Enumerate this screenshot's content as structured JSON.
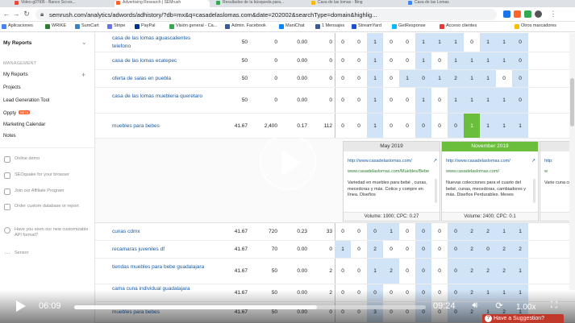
{
  "browser": {
    "tabs": [
      {
        "label": "Video-g07t06 - Banco Sci-ex...",
        "color": "#e74c3c"
      },
      {
        "label": "Advertising Research | SEMrush",
        "color": "#ff642d"
      },
      {
        "label": "Resultados de la búsqueda para...",
        "color": "#34a853"
      },
      {
        "label": "Casa de las lomas - Bing",
        "color": "#fbbc05"
      },
      {
        "label": "Casa de las Lomas",
        "color": "#4285f4"
      }
    ],
    "url": "semrush.com/analytics/adwords/adhistory/?db=mx&q=casadelaslomas.com&date=202002&searchType=domain&highlig..."
  },
  "bookmarks": [
    {
      "label": "Aplicaciones",
      "color": "#4285f4"
    },
    {
      "label": "WRIKE",
      "color": "#2e7d32"
    },
    {
      "label": "SumCart",
      "color": "#3b82c4"
    },
    {
      "label": "Stripe",
      "color": "#6772e5"
    },
    {
      "label": "PayPal",
      "color": "#003087"
    },
    {
      "label": "Visión general - Ca...",
      "color": "#34a853"
    },
    {
      "label": "Admin. Facebook",
      "color": "#3b5998"
    },
    {
      "label": "ManiChat",
      "color": "#0084ff"
    },
    {
      "label": "1 Mensajes",
      "color": "#3b5998"
    },
    {
      "label": "StreamYard",
      "color": "#1d4ed8"
    },
    {
      "label": "GetResponse",
      "color": "#00baff"
    },
    {
      "label": "Acceso clientes",
      "color": "#e53935"
    },
    {
      "label": "Otros marcadores",
      "color": "#fbbc05"
    }
  ],
  "sidebar": {
    "title": "My Reports",
    "section": "MANAGEMENT",
    "items": [
      {
        "label": "My Reports"
      },
      {
        "label": "Projects"
      },
      {
        "label": "Lead Generation Tool"
      },
      {
        "label": "Oppty",
        "badge": "BETA"
      },
      {
        "label": "Marketing Calendar"
      },
      {
        "label": "Notes"
      }
    ],
    "links": [
      {
        "label": "Online demo"
      },
      {
        "label": "SEOquake for your browser"
      },
      {
        "label": "Join our Affiliate Program"
      },
      {
        "label": "Order custom database or report"
      },
      {
        "label": "Have you seen our new customizable API format?"
      },
      {
        "label": "Sensor"
      }
    ]
  },
  "table": {
    "rows_top": [
      {
        "keyword": "casa de las lomas aguascalientes telefono",
        "kd": "50",
        "vol": "0",
        "cpc": "0.00",
        "com": "0",
        "trend": [
          "0",
          "0",
          "1",
          "0",
          "0",
          "1",
          "1",
          "1",
          "0",
          "1",
          "1",
          "0"
        ]
      },
      {
        "keyword": "casa de las lomas ecatepec",
        "kd": "50",
        "vol": "0",
        "cpc": "0.00",
        "com": "0",
        "trend": [
          "0",
          "0",
          "1",
          "0",
          "0",
          "1",
          "0",
          "1",
          "1",
          "1",
          "1",
          "0"
        ]
      },
      {
        "keyword": "oferta de salas en puebla",
        "kd": "50",
        "vol": "0",
        "cpc": "0.00",
        "com": "0",
        "trend": [
          "0",
          "0",
          "1",
          "0",
          "1",
          "0",
          "1",
          "2",
          "1",
          "1",
          "0",
          "0"
        ]
      },
      {
        "keyword": "casa de las lomas muebleria queretaro",
        "kd": "50",
        "vol": "0",
        "cpc": "0.00",
        "com": "0",
        "trend": [
          "0",
          "0",
          "1",
          "0",
          "0",
          "1",
          "0",
          "1",
          "1",
          "1",
          "1",
          "0"
        ]
      },
      {
        "keyword": "muebles para bebes",
        "kd": "41.67",
        "vol": "2,400",
        "cpc": "0.17",
        "com": "112",
        "trend": [
          "0",
          "0",
          "1",
          "0",
          "0",
          "0",
          "0",
          "0",
          "1",
          "1",
          "1",
          "1"
        ]
      }
    ],
    "snapshots": [
      {
        "month": "May 2019",
        "link": "http://www.casadelaslomas.com/",
        "display": "www.casadelaslomas.com/Muebles/Bebe",
        "desc": "Variedad en muebles para bebé , cunas, mecedoras y más. Cotice y compre en línea. Diseños",
        "foot": "Volume: 1900; CPC: 0.27"
      },
      {
        "month": "November 2019",
        "link": "http://www.casadelaslomas.com/",
        "display": "www.casadelaslomas.com/",
        "desc": "Nuevas colecciones para el cuarto del bebé, cunas, mecedoras, cambiadores y más. Diseños Perdurables. Meses",
        "foot": "Volume: 2400; CPC: 0.1"
      },
      {
        "month": "",
        "link": "http:",
        "display": "w",
        "desc": "Varie cuna comp",
        "foot": "Volume"
      }
    ],
    "rows_bottom": [
      {
        "keyword": "cunas cdmx",
        "kd": "41.67",
        "vol": "720",
        "cpc": "0.23",
        "com": "33",
        "trend": [
          "0",
          "0",
          "0",
          "1",
          "0",
          "0",
          "0",
          "0",
          "2",
          "2",
          "1",
          "1"
        ]
      },
      {
        "keyword": "recamaras juveniles df",
        "kd": "41.67",
        "vol": "70",
        "cpc": "0.00",
        "com": "0",
        "trend": [
          "1",
          "0",
          "2",
          "0",
          "0",
          "0",
          "0",
          "0",
          "2",
          "0",
          "2",
          "2"
        ]
      },
      {
        "keyword": "tiendas muebles para bebe guadalajara",
        "kd": "41.67",
        "vol": "50",
        "cpc": "0.00",
        "com": "2",
        "trend": [
          "0",
          "0",
          "1",
          "2",
          "0",
          "0",
          "0",
          "0",
          "2",
          "2",
          "2",
          "1"
        ]
      },
      {
        "keyword": "cama cuna individual guadalajara",
        "kd": "41.67",
        "vol": "50",
        "cpc": "0.00",
        "com": "2",
        "trend": [
          "0",
          "0",
          "0",
          "0",
          "0",
          "0",
          "0",
          "0",
          "2",
          "1",
          "1",
          "1"
        ]
      },
      {
        "keyword": "muebles para bebes",
        "kd": "41.67",
        "vol": "50",
        "cpc": "0.00",
        "com": "0",
        "trend": [
          "0",
          "0",
          "3",
          "0",
          "0",
          "0",
          "0",
          "0",
          "2",
          "1",
          "2",
          "1"
        ]
      }
    ]
  },
  "video": {
    "current_time": "06:09",
    "remaining_time": "09:24",
    "progress": 0.69,
    "speed": "1.00x",
    "suggestion": "Have a Suggestion?"
  }
}
